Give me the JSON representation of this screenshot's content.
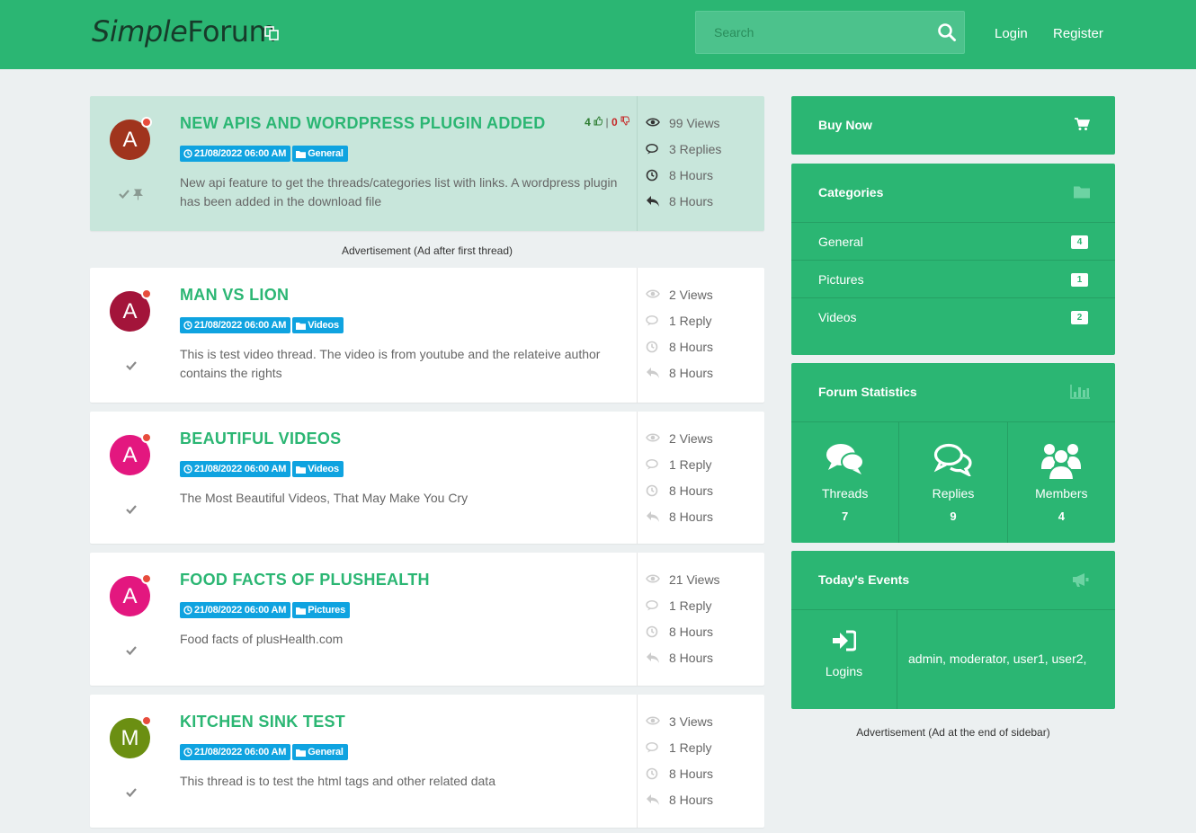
{
  "header": {
    "brand_light": "Simple",
    "brand_bold": "Forum",
    "search_placeholder": "Search",
    "login": "Login",
    "register": "Register"
  },
  "threads": [
    {
      "title": "NEW APIS AND WORDPRESS PLUGIN ADDED",
      "avatar": "A",
      "avatar_color": "#a0341d",
      "date": "21/08/2022 06:00 AM",
      "category": "General",
      "description": "New api feature to get the threads/categories list with links. A wordpress plugin has been added in the download file",
      "votes_up": "4",
      "votes_down": "0",
      "views": "99 Views",
      "replies": "3 Replies",
      "created": "8 Hours",
      "last_reply": "8 Hours"
    },
    {
      "title": "MAN VS LION",
      "avatar": "A",
      "avatar_color": "#a3143a",
      "date": "21/08/2022 06:00 AM",
      "category": "Videos",
      "description": "This is test video thread. The video is from youtube and the relateive author contains the rights",
      "views": "2 Views",
      "replies": "1 Reply",
      "created": "8 Hours",
      "last_reply": "8 Hours"
    },
    {
      "title": "BEAUTIFUL VIDEOS",
      "avatar": "A",
      "avatar_color": "#e3177f",
      "date": "21/08/2022 06:00 AM",
      "category": "Videos",
      "description": "The Most Beautiful Videos, That May Make You Cry",
      "views": "2 Views",
      "replies": "1 Reply",
      "created": "8 Hours",
      "last_reply": "8 Hours"
    },
    {
      "title": "FOOD FACTS OF PLUSHEALTH",
      "avatar": "A",
      "avatar_color": "#e3177f",
      "date": "21/08/2022 06:00 AM",
      "category": "Pictures",
      "description": "Food facts of plusHealth.com",
      "views": "21 Views",
      "replies": "1 Reply",
      "created": "8 Hours",
      "last_reply": "8 Hours"
    },
    {
      "title": "KITCHEN SINK TEST",
      "avatar": "M",
      "avatar_color": "#6b8f12",
      "date": "21/08/2022 06:00 AM",
      "category": "General",
      "description": "This thread is to test the html tags and other related data",
      "views": "3 Views",
      "replies": "1 Reply",
      "created": "8 Hours",
      "last_reply": "8 Hours"
    }
  ],
  "ad_after_first_thread": "Advertisement (Ad after first thread)",
  "sidebar": {
    "buy_now": "Buy Now",
    "categories_title": "Categories",
    "categories": [
      {
        "name": "General",
        "count": "4"
      },
      {
        "name": "Pictures",
        "count": "1"
      },
      {
        "name": "Videos",
        "count": "2"
      }
    ],
    "stats_title": "Forum Statistics",
    "stats": [
      {
        "label": "Threads",
        "value": "7"
      },
      {
        "label": "Replies",
        "value": "9"
      },
      {
        "label": "Members",
        "value": "4"
      }
    ],
    "events_title": "Today's Events",
    "logins_label": "Logins",
    "logins_users": "admin, moderator, user1, user2,",
    "ad_end_sidebar": "Advertisement (Ad at the end of sidebar)"
  },
  "colors": {
    "brand_green": "#2bb673",
    "badge_blue": "#0fa3e0",
    "sticky_bg": "#c8e6db"
  }
}
